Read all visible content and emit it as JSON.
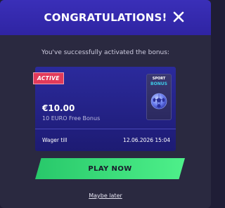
{
  "header": {
    "title": "CONGRATULATIONS!"
  },
  "subtitle": "You've successfully activated the bonus:",
  "bonus_card": {
    "badge": "ACTIVE",
    "amount": "€10.00",
    "name": "10 EURO Free Bonus",
    "wager_label": "Wager till",
    "wager_date": "12.06.2026 15:04",
    "image": {
      "top_label": "SPORT",
      "bottom_label": "BONUS",
      "icon": "soccer-ball-icon"
    }
  },
  "actions": {
    "primary_label": "PLAY NOW",
    "secondary_label": "Maybe later"
  },
  "colors": {
    "header_bg": "#3a2fb8",
    "card_bg": "#2b2a9c",
    "badge_bg": "#e23a5a",
    "primary_btn": "#3ee07a",
    "modal_bg": "#2a2940"
  }
}
